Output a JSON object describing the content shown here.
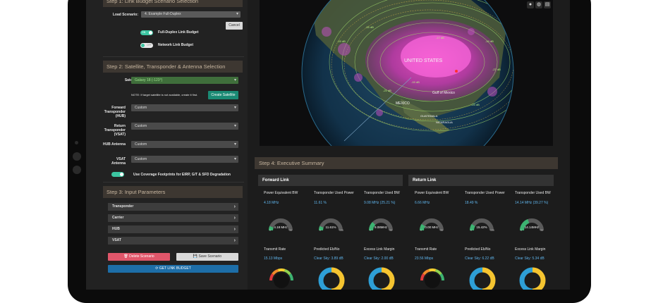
{
  "step1": {
    "header": "Step 1: Link Budget Scenario Selection",
    "load_scenario_label": "Load Scenario:",
    "load_scenario_value": "4. Example Full-Duplex",
    "cancel": "Cancel",
    "full_duplex_label": "Full-Duplex Link Budget",
    "network_label": "Network Link Budget",
    "toggle_on": "ON",
    "toggle_off": "OFF"
  },
  "step2": {
    "header": "Step 2: Satellite, Transponder & Antenna Selection",
    "satellite_label": "Satellite",
    "satellite_value": "Galaxy 18 (-123°)",
    "note": "NOTE: If target satellite is not available, create it first.",
    "create_satellite": "Create Satellite",
    "fields": [
      {
        "label": "Forward Transponder (HUB)",
        "value": "Custom"
      },
      {
        "label": "Return Transponder (VSAT)",
        "value": "Custom"
      },
      {
        "label": "HUB Antenna",
        "value": "Custom"
      },
      {
        "label": "VSAT Antenna",
        "value": "Custom"
      }
    ],
    "coverage_label": "Use Coverage Footprints for EIRP, G/T & SFD Degradation"
  },
  "step3": {
    "header": "Step 3: Input Parameters",
    "items": [
      "Transponder",
      "Carrier",
      "HUB",
      "VSAT"
    ],
    "delete": "Delete Scenario",
    "save": "Save Scenario",
    "get": "GET LINK BUDGET"
  },
  "map": {
    "labels": [
      "UNITED STATES",
      "MEXICO",
      "Gulf of Mexico",
      "GUATEMALA",
      "NICARAGUA"
    ],
    "contours": [
      "-29 dB",
      "-27 dB",
      "-25 dB",
      "-23 dB",
      "-21 dB",
      "-19 dB",
      "-17 dB",
      "-15 dB"
    ]
  },
  "step4": {
    "header": "Step 4: Executive Summary",
    "forward": {
      "title": "Forward Link",
      "metrics": [
        {
          "title": "Power Equivalent BW",
          "value": "4.18 MHz",
          "gauge": "4.18 MHz",
          "min": "0",
          "max": "36",
          "fraction": 0.12,
          "color": "#3cb371"
        },
        {
          "title": "Transponder Used Power",
          "value": "11.61 %",
          "gauge": "11.61%",
          "min": "0",
          "max": "100",
          "fraction": 0.12,
          "color": "#3cb371"
        },
        {
          "title": "Transponder Used BW",
          "value": "9.08 MHz   (25.21 %)",
          "gauge": "9.08MHz",
          "min": "0",
          "max": "36",
          "fraction": 0.25,
          "color": "#3cb371"
        }
      ],
      "row2": [
        {
          "title": "Transmit Rate",
          "value": "15.13 Mbps"
        },
        {
          "title": "Predicted Eb/No",
          "value": "Clear Sky: 3.89 dB"
        },
        {
          "title": "Excess Link Margin",
          "value": "Clear Sky: 2.00 dB"
        }
      ]
    },
    "return": {
      "title": "Return Link",
      "metrics": [
        {
          "title": "Power Equivalent BW",
          "value": "6.66 MHz",
          "gauge": "0.00 MHz",
          "min": "0",
          "max": "36",
          "fraction": 0.18,
          "color": "#3cb371"
        },
        {
          "title": "Transponder Used Power",
          "value": "18.49 %",
          "gauge": "15.42%",
          "min": "0",
          "max": "100",
          "fraction": 0.18,
          "color": "#3cb371"
        },
        {
          "title": "Transponder Used BW",
          "value": "14.14 MHz   (39.27 %)",
          "gauge": "14.14MHz",
          "min": "0",
          "max": "36",
          "fraction": 0.39,
          "color": "#3cb371"
        }
      ],
      "row2": [
        {
          "title": "Transmit Rate",
          "value": "23.56 Mbps"
        },
        {
          "title": "Predicted Eb/No",
          "value": "Clear Sky: 6.22 dB"
        },
        {
          "title": "Excess Link Margin",
          "value": "Clear Sky: 5.34 dB"
        }
      ]
    }
  }
}
